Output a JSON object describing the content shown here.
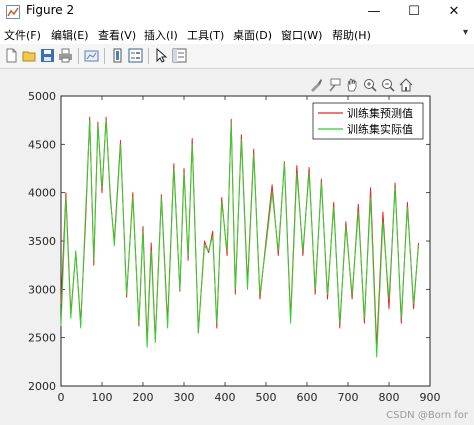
{
  "window": {
    "title": "Figure 2",
    "minimize_glyph": "—",
    "maximize_glyph": "☐",
    "close_glyph": "✕"
  },
  "menu": [
    "文件(F)",
    "编辑(E)",
    "查看(V)",
    "插入(I)",
    "工具(T)",
    "桌面(D)",
    "窗口(W)",
    "帮助(H)"
  ],
  "menu_overflow": "▾",
  "toolbar_icons": [
    "new-figure-icon",
    "open-file-icon",
    "save-icon",
    "print-icon",
    "link-plot-icon",
    "insert-colorbar-icon",
    "insert-legend-icon",
    "edit-plot-icon",
    "property-inspector-icon"
  ],
  "axes_toolbar_icons": [
    "brush-icon",
    "datatip-icon",
    "pan-icon",
    "zoom-in-icon",
    "zoom-out-icon",
    "home-icon"
  ],
  "watermark": "CSDN @Born for",
  "chart_data": {
    "type": "line",
    "title": "",
    "xlabel": "",
    "ylabel": "",
    "xlim": [
      0,
      900
    ],
    "ylim": [
      2000,
      5000
    ],
    "xticks": [
      0,
      100,
      200,
      300,
      400,
      500,
      600,
      700,
      800,
      900
    ],
    "yticks": [
      2000,
      2500,
      3000,
      3500,
      4000,
      4500,
      5000
    ],
    "grid": false,
    "legend_position": "top-right",
    "series": [
      {
        "name": "训练集预测值",
        "color": "#e8242b"
      },
      {
        "name": "训练集实际值",
        "color": "#2fd22f"
      }
    ],
    "x": [
      0,
      12,
      24,
      36,
      48,
      60,
      70,
      80,
      90,
      100,
      110,
      120,
      130,
      145,
      160,
      175,
      190,
      200,
      210,
      220,
      230,
      245,
      260,
      275,
      290,
      300,
      310,
      320,
      335,
      350,
      360,
      370,
      380,
      392,
      405,
      415,
      425,
      440,
      455,
      470,
      485,
      500,
      515,
      530,
      545,
      560,
      575,
      590,
      605,
      620,
      635,
      650,
      665,
      680,
      695,
      710,
      725,
      740,
      755,
      770,
      785,
      800,
      815,
      830,
      845,
      860,
      872
    ],
    "actual": [
      2620,
      3950,
      2700,
      3400,
      2600,
      3800,
      4750,
      3300,
      4700,
      4050,
      4750,
      4000,
      3450,
      4500,
      2950,
      3950,
      2650,
      3600,
      2400,
      3400,
      2450,
      3950,
      2600,
      4250,
      3000,
      4200,
      3350,
      4500,
      2550,
      3450,
      3400,
      3550,
      2650,
      3900,
      3400,
      4720,
      3000,
      4550,
      3000,
      4400,
      2950,
      3450,
      4000,
      3400,
      4300,
      2650,
      4200,
      3400,
      4200,
      3000,
      4100,
      2950,
      3850,
      2650,
      3650,
      2950,
      3800,
      2700,
      3950,
      2300,
      3700,
      2900,
      4050,
      2700,
      3850,
      2850,
      3450
    ],
    "predicted": [
      2850,
      4000,
      2750,
      3380,
      2650,
      3700,
      4780,
      3250,
      4730,
      4000,
      4780,
      3950,
      3500,
      4540,
      2920,
      4000,
      2620,
      3650,
      2450,
      3480,
      2480,
      3980,
      2650,
      4300,
      2980,
      4250,
      3300,
      4560,
      2550,
      3500,
      3380,
      3600,
      2600,
      3950,
      3350,
      4760,
      2950,
      4600,
      3050,
      4450,
      2900,
      3500,
      4080,
      3350,
      4320,
      2700,
      4280,
      3350,
      4260,
      2950,
      4140,
      2900,
      3900,
      2600,
      3700,
      2900,
      3880,
      2650,
      4050,
      2400,
      3800,
      2800,
      4100,
      2650,
      3900,
      2800,
      3480
    ]
  }
}
